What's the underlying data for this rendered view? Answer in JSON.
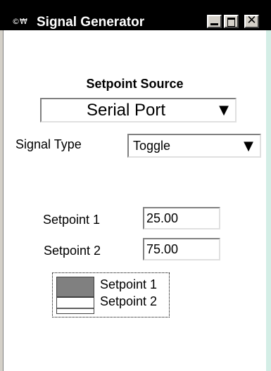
{
  "window": {
    "title": "Signal Generator",
    "icon_label": "©₩",
    "controls": [
      "minimize-icon",
      "maximize-icon",
      "close-icon"
    ],
    "titlebar_color": "#000000",
    "background_color": "#d4eee6"
  },
  "setpoint_source": {
    "label": "Setpoint Source",
    "selected": "Serial Port"
  },
  "signal_type": {
    "label": "Signal Type",
    "selected": "Toggle"
  },
  "setpoints": [
    {
      "label": "Setpoint 1",
      "value": "25.00"
    },
    {
      "label": "Setpoint 2",
      "value": "75.00"
    }
  ],
  "legend": {
    "items": [
      {
        "label": "Setpoint 1",
        "color": "#808080"
      },
      {
        "label": "Setpoint 2",
        "color": "#ffffff"
      }
    ]
  }
}
